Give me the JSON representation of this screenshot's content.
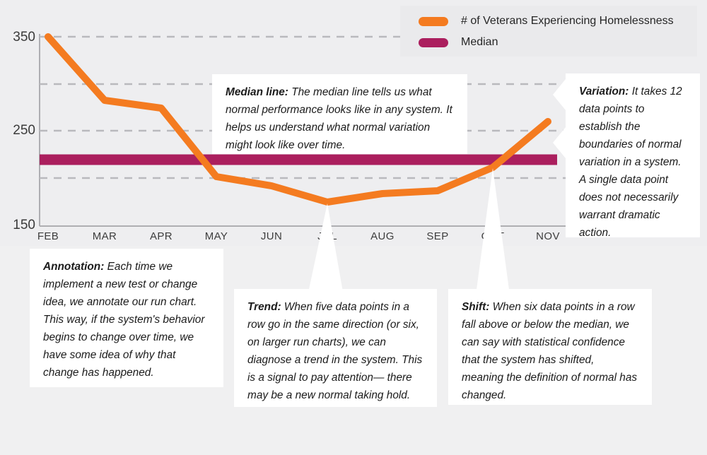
{
  "chart_data": {
    "type": "line",
    "title": "",
    "xlabel": "",
    "ylabel": "",
    "categories": [
      "FEB",
      "MAR",
      "APR",
      "MAY",
      "JUN",
      "JUL",
      "AUG",
      "SEP",
      "OCT",
      "NOV"
    ],
    "ylim": [
      150,
      350
    ],
    "y_ticks_labeled": [
      350,
      250,
      150
    ],
    "y_gridlines": [
      350,
      300,
      250,
      200
    ],
    "grid": true,
    "legend_position": "top-right",
    "series": [
      {
        "name": "# of Veterans Experiencing Homelessness",
        "color": "#f47b20",
        "values": [
          350,
          283,
          275,
          200,
          190,
          178,
          187,
          190,
          215,
          258
        ]
      },
      {
        "name": "Median",
        "color": "#ab1f5e",
        "type": "reference-line",
        "value": 222
      }
    ]
  },
  "legend": {
    "items": [
      {
        "label": "# of Veterans Experiencing Homelessness",
        "color": "#f47b20"
      },
      {
        "label": "Median",
        "color": "#ab1f5e"
      }
    ]
  },
  "axis": {
    "y_labels": [
      "350",
      "250",
      "150"
    ],
    "x_labels": [
      "FEB",
      "MAR",
      "APR",
      "MAY",
      "JUN",
      "JUL",
      "AUG",
      "SEP",
      "OCT",
      "NOV"
    ]
  },
  "callouts": {
    "median_line": {
      "term": "Median line:",
      "body": " The median line tells us what normal performance looks like in any system. It helps us understand what normal variation might look like over time."
    },
    "variation": {
      "term": "Variation:",
      "body": " It takes 12 data points to establish the boundaries of normal variation in a system. A single data point does not necessarily warrant dramatic action."
    },
    "annotation": {
      "term": "Annotation:",
      "body": " Each time we implement a new test or change idea, we annotate our run chart. This way, if the system's behavior begins to change over time, we have some idea of why that change has happened."
    },
    "trend": {
      "term": "Trend:",
      "body": " When five data points in a row go in the same direction (or six, on larger run charts), we can diagnose a trend in the system. This is a signal to pay attention— there may be a new normal taking hold."
    },
    "shift": {
      "term": "Shift:",
      "body": " When six data points in a row fall above or below the median, we can say with statistical confidence that the system has shifted, meaning the definition of normal has changed."
    }
  },
  "colors": {
    "series_orange": "#f47b20",
    "median_magenta": "#ab1f5e",
    "page_background": "#f0f0f1",
    "chart_background": "#eeeef0",
    "gridline": "#b9b9bd"
  }
}
